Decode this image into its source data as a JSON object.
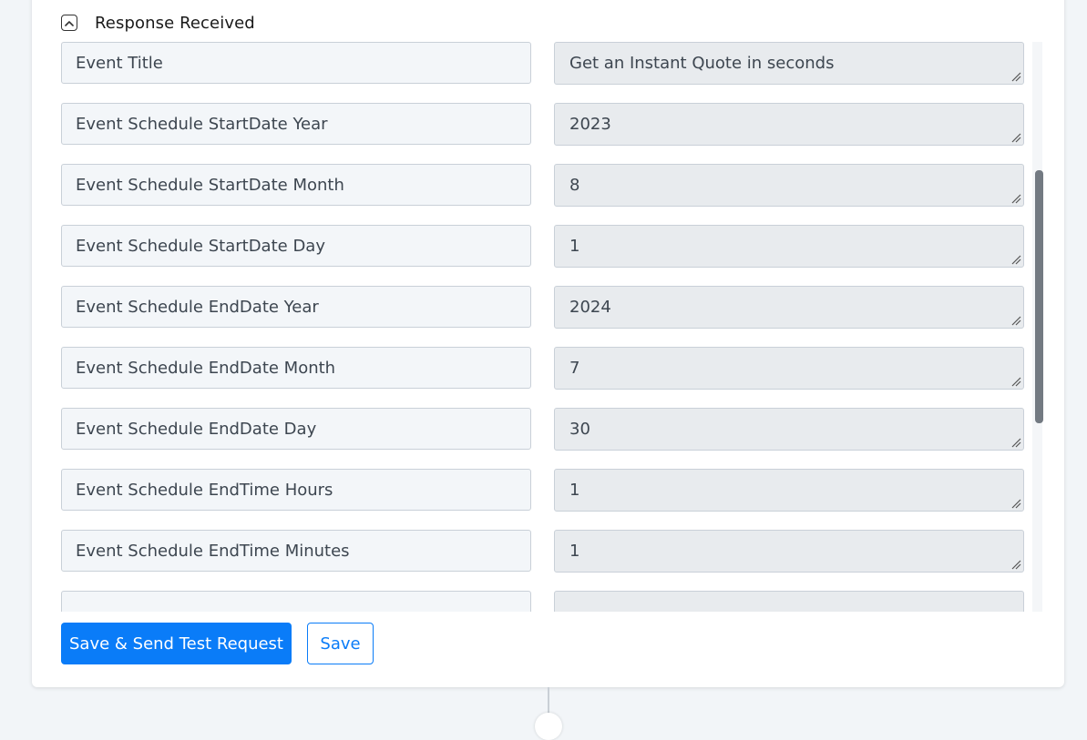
{
  "section": {
    "title": "Response Received",
    "toggle_icon": "chevron-up-icon"
  },
  "fields": [
    {
      "key": "Event Title",
      "value": "Get an Instant Quote in seconds"
    },
    {
      "key": "Event Schedule StartDate Year",
      "value": "2023"
    },
    {
      "key": "Event Schedule StartDate Month",
      "value": "8"
    },
    {
      "key": "Event Schedule StartDate Day",
      "value": "1"
    },
    {
      "key": "Event Schedule EndDate Year",
      "value": "2024"
    },
    {
      "key": "Event Schedule EndDate Month",
      "value": "7"
    },
    {
      "key": "Event Schedule EndDate Day",
      "value": "30"
    },
    {
      "key": "Event Schedule EndTime Hours",
      "value": "1"
    },
    {
      "key": "Event Schedule EndTime Minutes",
      "value": "1"
    },
    {
      "key": "",
      "value": ""
    }
  ],
  "actions": {
    "save_send_label": "Save & Send Test Request",
    "save_label": "Save"
  },
  "colors": {
    "primary": "#0a7cf8",
    "key_bg": "#f3f6f9",
    "value_bg": "#e8ebee",
    "border": "#c9d0d8",
    "page_bg": "#f2f5f8"
  }
}
